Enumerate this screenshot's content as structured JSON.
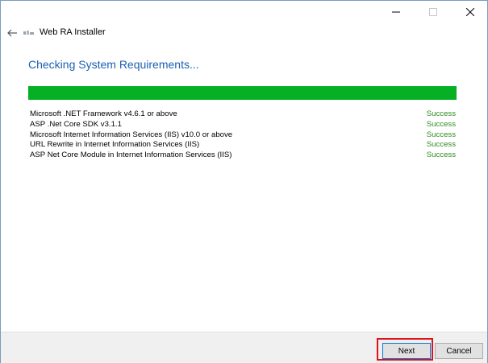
{
  "window": {
    "caption_icons": {
      "minimize": "minimize-icon",
      "maximize": "maximize-icon",
      "close": "close-icon"
    }
  },
  "header": {
    "back_icon": "back-arrow-icon",
    "logo_icon": "app-logo-icon",
    "title": "Web RA  Installer"
  },
  "main": {
    "heading": "Checking System Requirements...",
    "progress": {
      "fraction": 1.0,
      "color": "#06b025"
    },
    "requirements": [
      {
        "name": "Microsoft .NET Framework v4.6.1 or above",
        "status": "Success"
      },
      {
        "name": "ASP .Net Core SDK v3.1.1",
        "status": "Success"
      },
      {
        "name": "Microsoft Internet Information Services (IIS) v10.0 or above",
        "status": "Success"
      },
      {
        "name": "URL Rewrite in Internet Information Services (IIS)",
        "status": "Success"
      },
      {
        "name": "ASP Net Core Module in Internet Information Services (IIS)",
        "status": "Success"
      }
    ]
  },
  "footer": {
    "next_label": "Next",
    "cancel_label": "Cancel"
  },
  "colors": {
    "heading": "#1a5fb4",
    "success": "#2e8b1f",
    "highlight": "#e0111a"
  }
}
